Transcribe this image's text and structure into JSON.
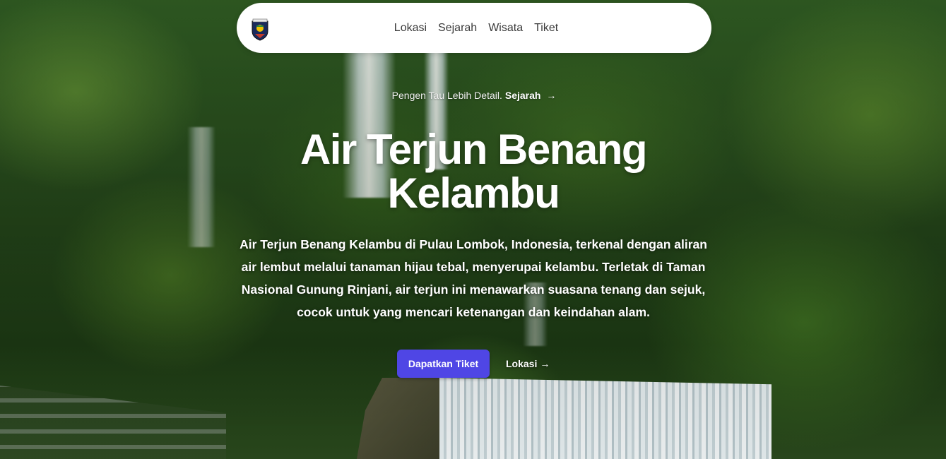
{
  "nav": {
    "logo": "coat-of-arms-icon",
    "links": [
      "Lokasi",
      "Sejarah",
      "Wisata",
      "Tiket"
    ]
  },
  "announcement": {
    "text": "Pengen Tau Lebih Detail.",
    "link_label": "Sejarah",
    "arrow": "→"
  },
  "hero": {
    "title": "Air Terjun Benang Kelambu",
    "description": "Air Terjun Benang Kelambu di Pulau Lombok, Indonesia, terkenal dengan aliran air lembut melalui tanaman hijau tebal, menyerupai kelambu. Terletak di Taman Nasional Gunung Rinjani, air terjun ini menawarkan suasana tenang dan sejuk, cocok untuk yang mencari ketenangan dan keindahan alam.",
    "primary_button": "Dapatkan Tiket",
    "secondary_link": "Lokasi",
    "secondary_arrow": "→"
  },
  "colors": {
    "accent": "#4f46e5",
    "nav_bg": "#ffffff",
    "nav_text": "#3a3a3a"
  }
}
